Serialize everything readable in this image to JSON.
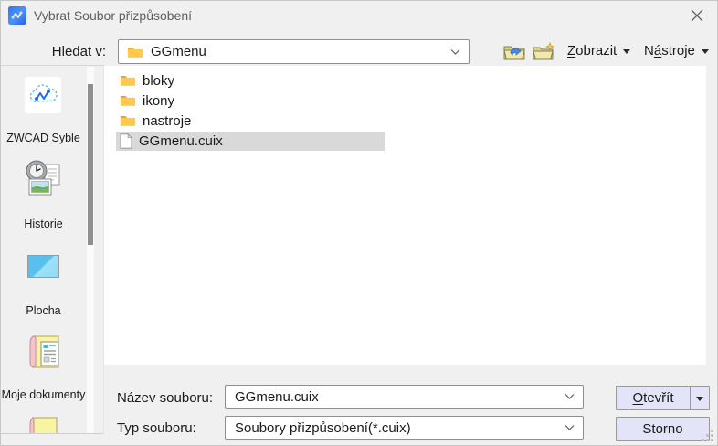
{
  "window": {
    "title": "Vybrat Soubor přizpůsobení"
  },
  "toolbar": {
    "look_in_label": "Hledat v:",
    "location_value": "GGmenu",
    "menus": {
      "zobrazit": {
        "pre": "",
        "u": "Z",
        "rest": "obrazit"
      },
      "nastroje": {
        "pre": "N",
        "u": "á",
        "rest": "stroje"
      }
    }
  },
  "sidebar": {
    "items": [
      {
        "label": "ZWCAD Syble",
        "icon": "zwcad-cloud-icon"
      },
      {
        "label": "Historie",
        "icon": "history-icon"
      },
      {
        "label": "Plocha",
        "icon": "desktop-icon"
      },
      {
        "label": "Moje dokumenty",
        "icon": "my-documents-icon"
      },
      {
        "label": "",
        "icon": "folder-partial-icon"
      }
    ]
  },
  "file_list": {
    "items": [
      {
        "name": "bloky",
        "type": "folder"
      },
      {
        "name": "ikony",
        "type": "folder"
      },
      {
        "name": "nastroje",
        "type": "folder"
      },
      {
        "name": "GGmenu.cuix",
        "type": "file",
        "selected": true
      }
    ]
  },
  "form": {
    "file_name_label": "Název souboru:",
    "file_name_value": "GGmenu.cuix",
    "file_type_label": "Typ souboru:",
    "file_type_value": "Soubory přizpůsobení(*.cuix)"
  },
  "buttons": {
    "open": {
      "u": "O",
      "rest": "tevřít"
    },
    "cancel": "Storno"
  },
  "colors": {
    "button_bg": "#e4e4f8",
    "selection_bg": "#d9d9d9",
    "folder_yellow": "#ffc94c",
    "titlebar_text": "#5f5f5f"
  }
}
